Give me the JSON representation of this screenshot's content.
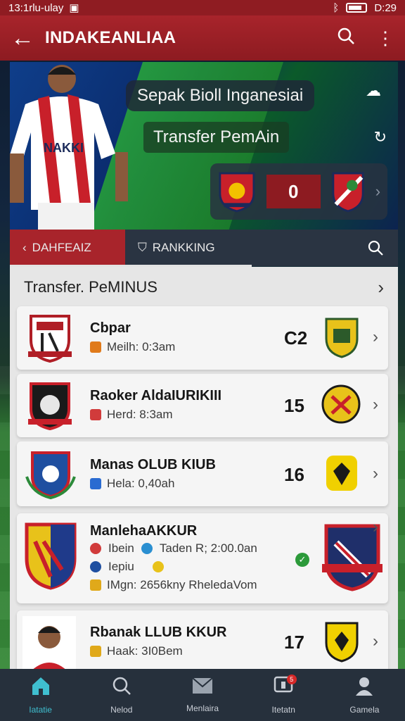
{
  "status_bar": {
    "left_text": "13:1rlu-ulay",
    "time": "D:29"
  },
  "app_bar": {
    "title": "INDAKEANLIAA"
  },
  "hero": {
    "title": "Sepak Bioll Inganesiai",
    "subtitle": "Transfer PemAin",
    "match_score": "0",
    "player_shirt_text": "NAKKI"
  },
  "tabs": [
    {
      "label": "DAHFEAIZ",
      "active": true
    },
    {
      "label": "RANKKING",
      "active": false
    }
  ],
  "panel": {
    "header": "Transfer. PeMINUS",
    "items": [
      {
        "name": "Cbpar",
        "meta": "Meilh: 0:3am",
        "number": "C2",
        "meta_color": "#e07a1a"
      },
      {
        "name": "Raoker AldaIURIKIII",
        "meta": "Herd: 8:3am",
        "number": "15",
        "meta_color": "#d13b3b"
      },
      {
        "name": "Manas OLUB KIUB",
        "meta": "Hela: 0,40ah",
        "number": "16",
        "meta_color": "#2a6bd1"
      },
      {
        "name": "ManlehaAKKUR",
        "lines": [
          "Ibein",
          "Taden R; 2:00.0an",
          "Iepiu",
          "IMgn: 2656kny RheledaVom"
        ],
        "number": ""
      },
      {
        "name": "Rbanak LLUB KKUR",
        "meta": "Haak: 3I0Bem",
        "number": "17",
        "meta_color": "#e0a91a"
      }
    ]
  },
  "bottom_nav": [
    {
      "label": "Iatatie",
      "icon": "home-icon",
      "active": true
    },
    {
      "label": "Nelod",
      "icon": "search-icon",
      "active": false
    },
    {
      "label": "Menlaira",
      "icon": "mail-icon",
      "active": false
    },
    {
      "label": "Itetatn",
      "icon": "chat-icon",
      "active": false,
      "badge": "5"
    },
    {
      "label": "Gamela",
      "icon": "profile-icon",
      "active": false
    }
  ],
  "colors": {
    "primary_red": "#a8242b",
    "nav_active": "#3fbfd0",
    "panel_bg": "#e6e6e6"
  }
}
